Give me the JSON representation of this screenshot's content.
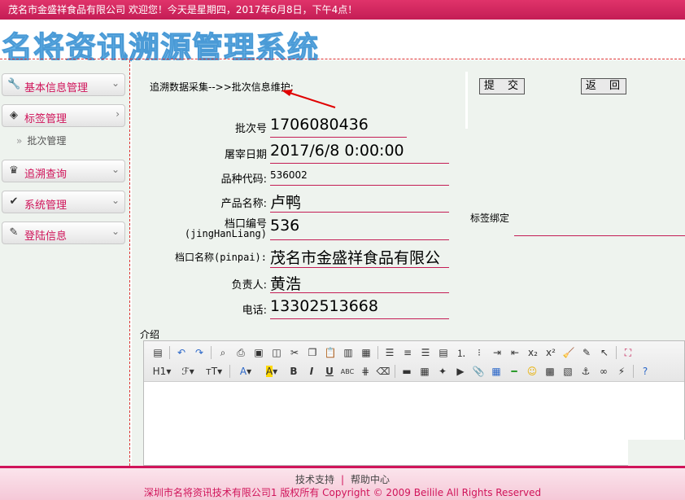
{
  "topbar": {
    "welcome_text": "茂名市金盛祥食品有限公司 欢迎您！今天是星期四，2017年6月8日，下午4点！"
  },
  "logo": {
    "text": "名将资讯溯源管理系统"
  },
  "sidebar": {
    "items": [
      {
        "label": "基本信息管理",
        "icon": "wrench-icon"
      },
      {
        "label": "标签管理",
        "icon": "diamond-icon"
      },
      {
        "label": "追溯查询",
        "icon": "crown-icon"
      },
      {
        "label": "系统管理",
        "icon": "checkmark-icon"
      },
      {
        "label": "登陆信息",
        "icon": "pencil-icon"
      }
    ],
    "sub_item": {
      "arrow": "»",
      "label": "批次管理"
    }
  },
  "main": {
    "breadcrumb": "追溯数据采集-->>批次信息维护:",
    "submit_label": "提 交",
    "back_label": "返 回",
    "fields": [
      {
        "label": "批次号",
        "value": "1706080436"
      },
      {
        "label": "屠宰日期",
        "value": "2017/6/8 0:00:00"
      },
      {
        "label": "品种代码:",
        "value": "536002"
      },
      {
        "label": "产品名称:",
        "value": "卢鸭"
      },
      {
        "label": "档口编号",
        "label2": "(jingHanLiang)",
        "value": "536"
      },
      {
        "label": "档口名称(pinpai):",
        "value": "茂名市金盛祥食品有限公"
      },
      {
        "label": "负责人:",
        "value": "黄浩"
      },
      {
        "label": "电话:",
        "value": "13302513668"
      }
    ],
    "tag_bind_label": "标签绑定",
    "intro_label": "介绍"
  },
  "editor": {
    "h1": "H1",
    "font": "ℱ",
    "size": "ᴛT"
  },
  "footer": {
    "support": "技术支持",
    "help": "帮助中心",
    "copyright": "深圳市名将资讯技术有限公司1  版权所有  Copyright © 2009 Beilile All Rights Reserved"
  },
  "colors": {
    "brand": "#d0145a",
    "logo_blue": "#6bb6e8",
    "panel_bg": "#eef3ee"
  }
}
